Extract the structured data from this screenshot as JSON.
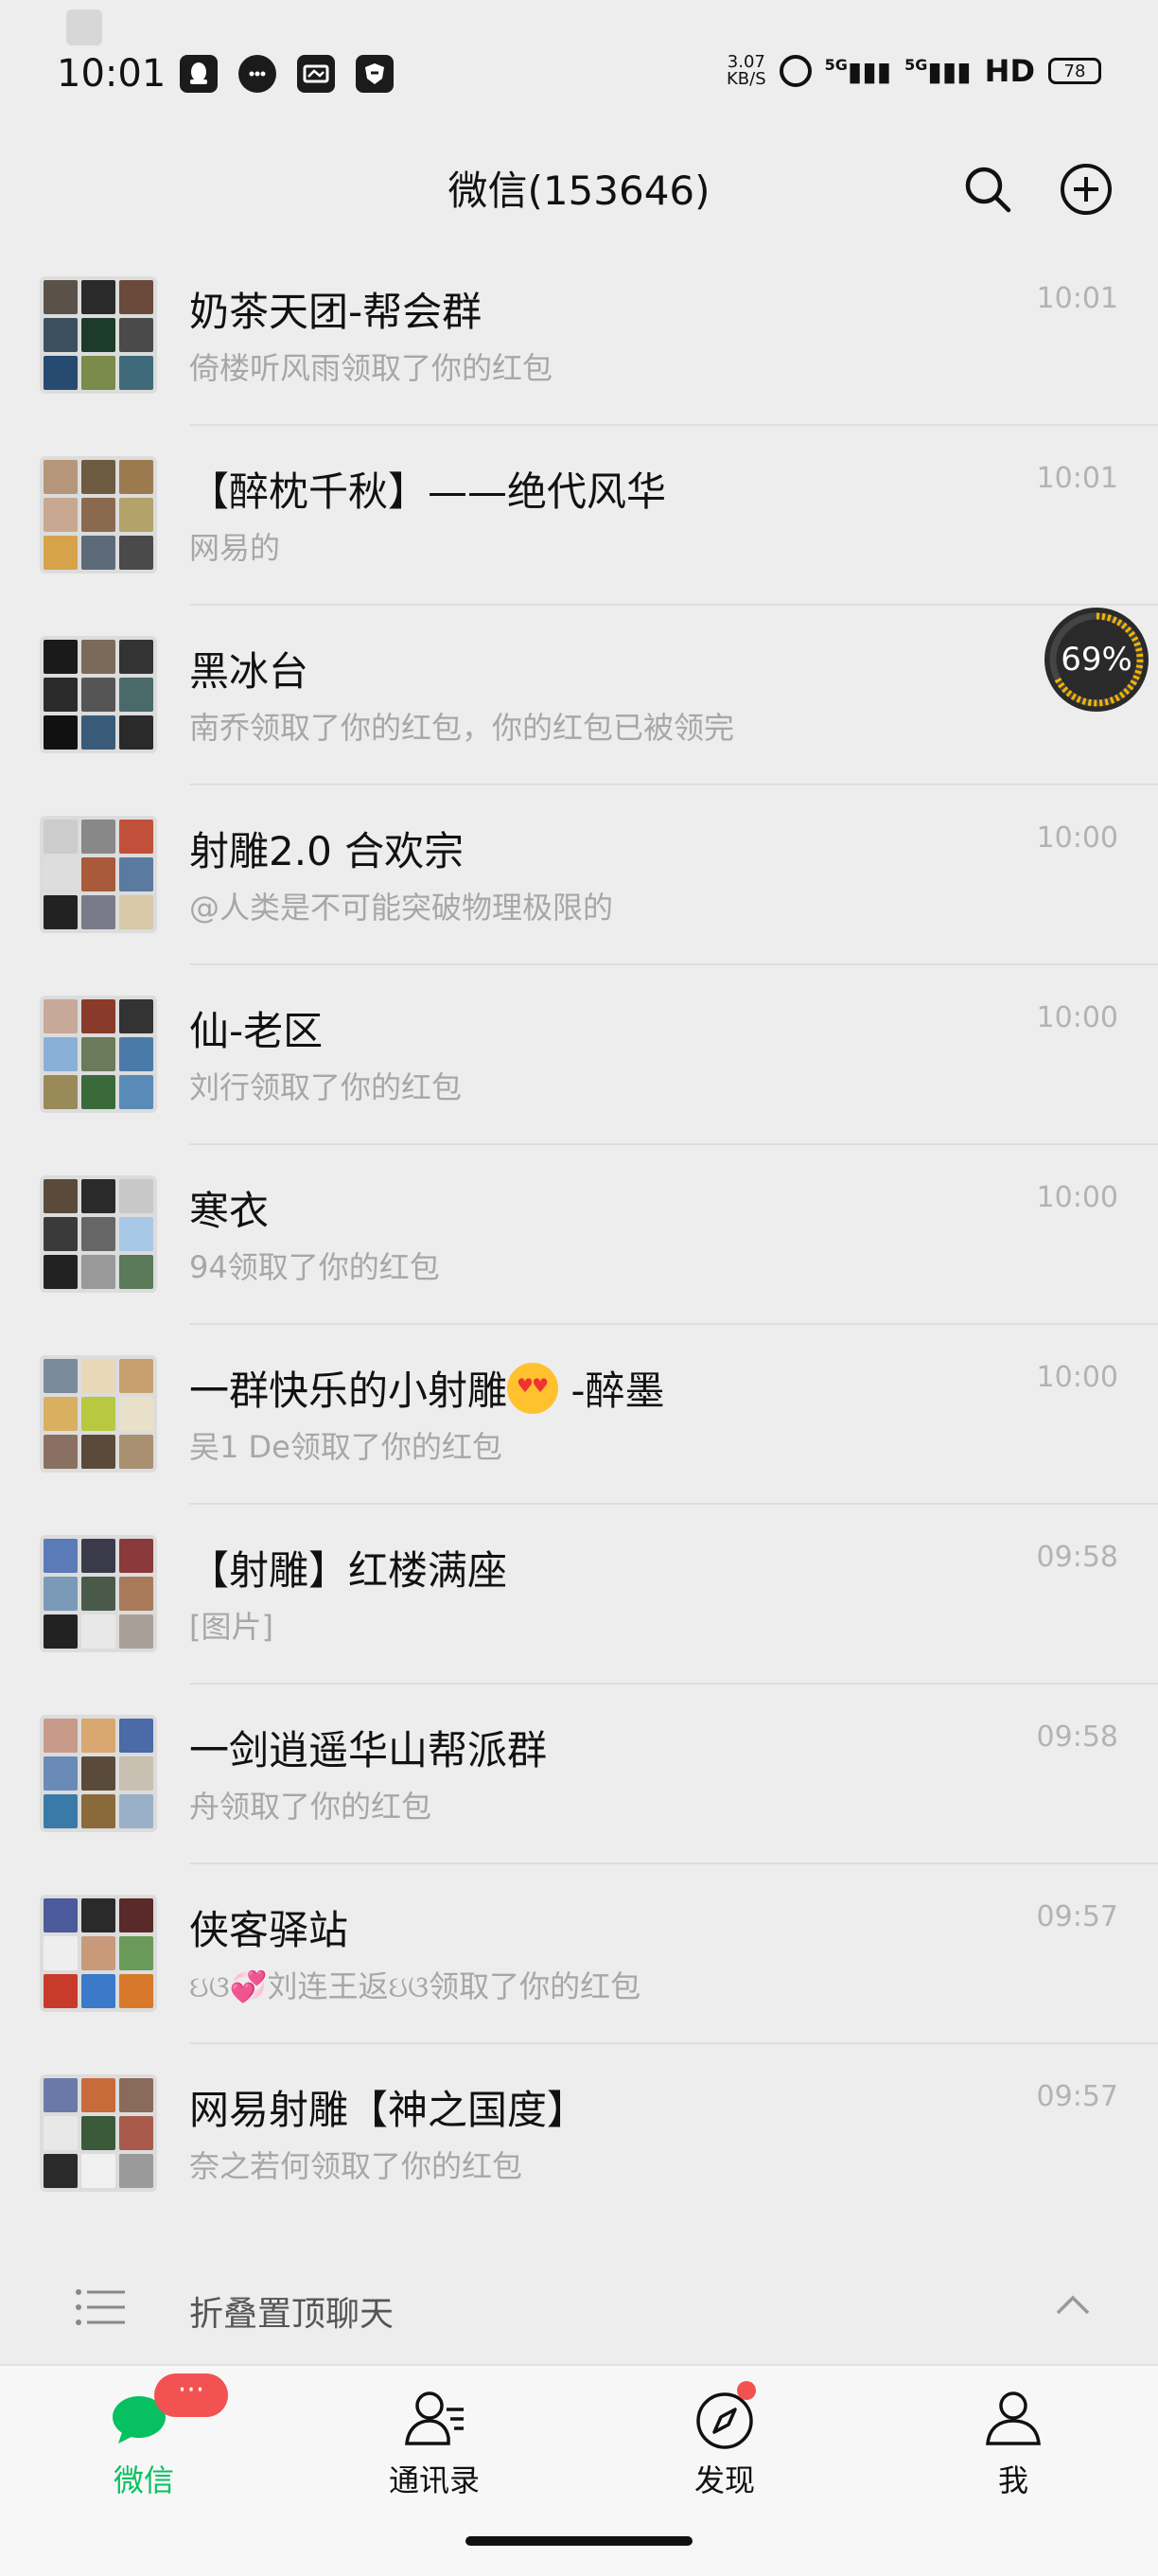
{
  "status_bar": {
    "time": "10:01",
    "net_speed_value": "3.07",
    "net_speed_unit": "KB/S",
    "signal_1": "5G",
    "signal_2": "5G",
    "hd_label": "HD",
    "battery_level": "78"
  },
  "header": {
    "title": "微信(153646)"
  },
  "chats": [
    {
      "name": "奶茶天团-帮会群",
      "preview": "倚楼听风雨领取了你的红包",
      "time": "10:01"
    },
    {
      "name": "【醉枕千秋】——绝代风华",
      "preview": "网易的",
      "time": "10:01"
    },
    {
      "name": "黑冰台",
      "preview": "南乔领取了你的红包，你的红包已被领完",
      "time": ""
    },
    {
      "name": "射雕2.0  合欢宗",
      "preview": "@人类是不可能突破物理极限的",
      "time": "10:00"
    },
    {
      "name": "仙-老区",
      "preview": "刘行领取了你的红包",
      "time": "10:00"
    },
    {
      "name": "寒衣",
      "preview": "94领取了你的红包",
      "time": "10:00"
    },
    {
      "name_before": "一群快乐的小射雕",
      "name_after": " -醉墨",
      "preview": "吴1 De领取了你的红包",
      "time": "10:00"
    },
    {
      "name": "【射雕】红楼满座",
      "preview": "[图片]",
      "time": "09:58"
    },
    {
      "name": "一剑逍遥华山帮派群",
      "preview": "舟领取了你的红包",
      "time": "09:58"
    },
    {
      "name": "侠客驿站",
      "preview": "ઇଓ💞刘连王返ઇଓ领取了你的红包",
      "time": "09:57"
    },
    {
      "name": "网易射雕【神之国度】",
      "preview": "奈之若何领取了你的红包",
      "time": "09:57"
    }
  ],
  "progress": {
    "percent_text": "69%",
    "value": 0.69
  },
  "fold": {
    "label": "折叠置顶聊天"
  },
  "tabbar": {
    "tabs": [
      {
        "label": "微信"
      },
      {
        "label": "通讯录"
      },
      {
        "label": "发现"
      },
      {
        "label": "我"
      }
    ],
    "chat_badge": "···"
  },
  "colors": {
    "accent": "#07c160",
    "badge": "#f25252",
    "background": "#ededed"
  }
}
